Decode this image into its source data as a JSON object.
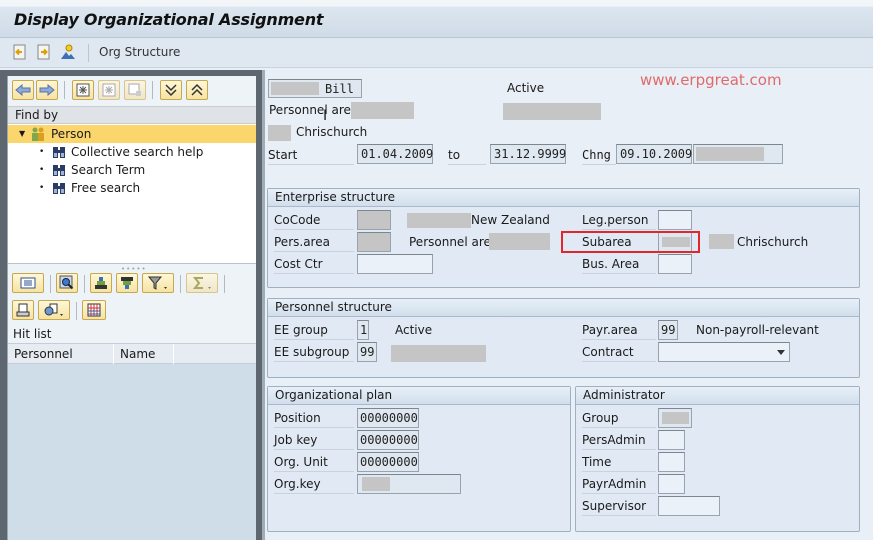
{
  "window": {
    "title": "Display Organizational Assignment"
  },
  "toolbar": {
    "icons": [
      "previous-record-icon",
      "next-record-icon",
      "org-structure-icon"
    ],
    "org_structure_label": "Org Structure"
  },
  "left_panel": {
    "nav_buttons": [
      "back-icon",
      "forward-icon",
      "create-icon",
      "select-icon",
      "delete-icon",
      "expand-icon",
      "collapse-icon"
    ],
    "find_by_label": "Find by",
    "tree": {
      "root": {
        "label": "Person",
        "expanded": true,
        "selected": true
      },
      "children": [
        {
          "label": "Collective search help"
        },
        {
          "label": "Search Term"
        },
        {
          "label": "Free search"
        }
      ]
    },
    "alv_toolbar_1": [
      "details-icon",
      "find-icon",
      "sort-ascending-icon",
      "sort-descending-icon",
      "filter-icon",
      "sum-icon"
    ],
    "alv_toolbar_2": [
      "print-icon",
      "export-icon",
      "layout-icon"
    ],
    "hit_list_label": "Hit list",
    "columns": [
      "Personnel numb...",
      "Name"
    ],
    "rows": []
  },
  "header": {
    "employee_name": "Bill",
    "status": "Active",
    "personnel_area_label": "Personnel area",
    "city": "Chrischurch",
    "start_label": "Start",
    "start_date": "01.04.2009",
    "to_label": "to",
    "end_date": "31.12.9999",
    "changed_label": "Chng",
    "changed_date": "09.10.2009"
  },
  "watermark": "www.erpgreat.com",
  "enterprise_structure": {
    "title": "Enterprise structure",
    "cocode_label": "CoCode",
    "cocode_text": "New Zealand",
    "pers_area_label": "Pers.area",
    "personnel_area_text": "Personnel area",
    "cost_ctr_label": "Cost Ctr",
    "cost_ctr_value": "",
    "leg_person_label": "Leg.person",
    "leg_person_value": "",
    "subarea_label": "Subarea",
    "subarea_text": "Chrischurch",
    "bus_area_label": "Bus. Area",
    "bus_area_value": ""
  },
  "personnel_structure": {
    "title": "Personnel structure",
    "ee_group_label": "EE group",
    "ee_group_value": "1",
    "ee_group_text": "Active",
    "ee_subgroup_label": "EE subgroup",
    "ee_subgroup_value": "99",
    "payr_area_label": "Payr.area",
    "payr_area_value": "99",
    "payr_area_text": "Non-payroll-relevant",
    "contract_label": "Contract",
    "contract_value": ""
  },
  "organizational_plan": {
    "title": "Organizational plan",
    "position_label": "Position",
    "position_value": "00000000",
    "job_key_label": "Job key",
    "job_key_value": "00000000",
    "org_unit_label": "Org. Unit",
    "org_unit_value": "00000000",
    "org_key_label": "Org.key"
  },
  "administrator": {
    "title": "Administrator",
    "group_label": "Group",
    "pers_admin_label": "PersAdmin",
    "pers_admin_value": "",
    "time_label": "Time",
    "time_value": "",
    "payr_admin_label": "PayrAdmin",
    "payr_admin_value": "",
    "supervisor_label": "Supervisor",
    "supervisor_value": ""
  },
  "colors": {
    "highlight": "#e0272b",
    "tree_selection": "#fbd66c",
    "watermark": "#e06a6a"
  }
}
